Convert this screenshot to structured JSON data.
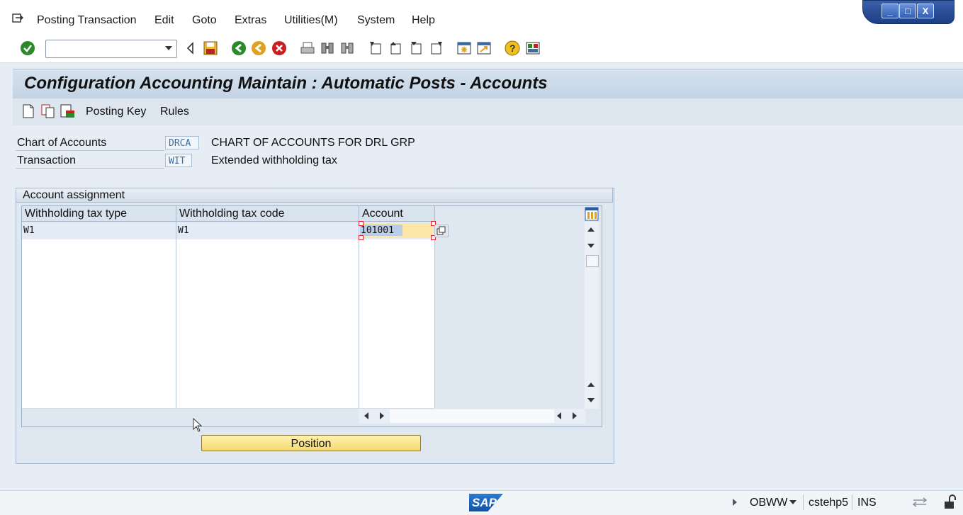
{
  "menu": {
    "items": [
      "Posting Transaction",
      "Edit",
      "Goto",
      "Extras",
      "Utilities(M)",
      "System",
      "Help"
    ]
  },
  "window_controls": {
    "minimize": "_",
    "maximize": "□",
    "close": "X"
  },
  "toolbar": {
    "command_field_value": "",
    "icons": [
      "enter-icon",
      "back-nav-icon",
      "save-icon",
      "back-icon",
      "exit-icon",
      "cancel-icon",
      "print-icon",
      "find-icon",
      "find-next-icon",
      "first-page-icon",
      "previous-page-icon",
      "next-page-icon",
      "last-page-icon",
      "new-session-icon",
      "shortcut-icon",
      "help-icon",
      "layout-menu-icon"
    ]
  },
  "title": "Configuration Accounting Maintain : Automatic Posts - Accounts",
  "app_toolbar": {
    "icons": [
      "new-entries-icon",
      "copy-as-icon",
      "delete-icon"
    ],
    "posting_key": "Posting Key",
    "rules": "Rules"
  },
  "header_fields": {
    "chart_of_accounts": {
      "label": "Chart of Accounts",
      "value": "DRCA",
      "description": "CHART OF ACCOUNTS FOR DRL GRP"
    },
    "transaction": {
      "label": "Transaction",
      "value": "WIT",
      "description": "Extended withholding tax"
    }
  },
  "account_assignment": {
    "title": "Account assignment",
    "columns": [
      "Withholding tax type",
      "Withholding tax code",
      "Account"
    ],
    "rows": [
      {
        "type": "W1",
        "code": "W1",
        "account": "101001"
      }
    ]
  },
  "position_button": "Position",
  "status_bar": {
    "transaction": "OBWW",
    "server": "cstehp5",
    "mode": "INS"
  },
  "colors": {
    "title_bg": "#c9d8e8",
    "highlight": "#fbe8a8",
    "button_yellow": "#f5d970",
    "sap_blue": "#1a64bf"
  }
}
